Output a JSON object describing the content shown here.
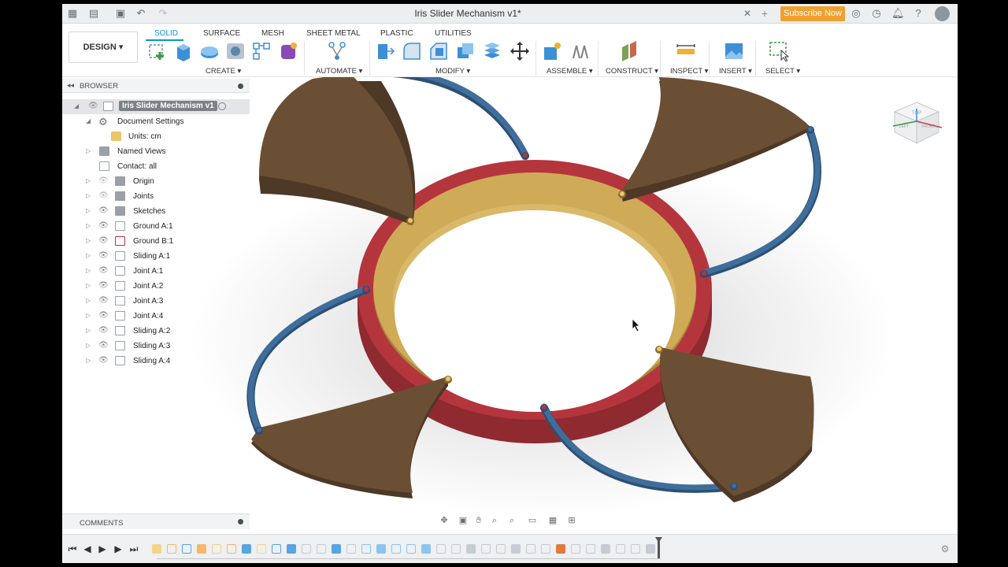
{
  "window": {
    "title": "Iris Slider Mechanism v1*",
    "subscribe_label": "Subscribe Now"
  },
  "ribbon": {
    "workspace": "DESIGN ▾",
    "tabs": [
      "SOLID",
      "SURFACE",
      "MESH",
      "SHEET METAL",
      "PLASTIC",
      "UTILITIES"
    ],
    "groups": [
      "CREATE ▾",
      "AUTOMATE ▾",
      "MODIFY ▾",
      "ASSEMBLE ▾",
      "CONSTRUCT ▾",
      "INSPECT ▾",
      "INSERT ▾",
      "SELECT ▾"
    ],
    "accent": "#0696d7"
  },
  "browser": {
    "header": "BROWSER",
    "root": "Iris Slider Mechanism v1",
    "items": [
      {
        "label": "Document Settings"
      },
      {
        "label": "Units: cm"
      },
      {
        "label": "Named Views"
      },
      {
        "label": "Contact: all"
      },
      {
        "label": "Origin"
      },
      {
        "label": "Joints"
      },
      {
        "label": "Sketches"
      },
      {
        "label": "Ground A:1"
      },
      {
        "label": "Ground B:1"
      },
      {
        "label": "Sliding A:1"
      },
      {
        "label": "Joint A:1"
      },
      {
        "label": "Joint A:2"
      },
      {
        "label": "Joint A:3"
      },
      {
        "label": "Joint A:4"
      },
      {
        "label": "Sliding A:2"
      },
      {
        "label": "Sliding A:3"
      },
      {
        "label": "Sliding A:4"
      }
    ]
  },
  "comments": {
    "header": "COMMENTS"
  },
  "viewcube": {
    "top": "TOP",
    "front": "FRONT",
    "left": "LEFT"
  },
  "colors": {
    "blade": "#6b4f34",
    "ring_outer": "#b5353d",
    "ring_inner": "#cfab57",
    "arm": "#3f6e9c",
    "subscribe": "#f0a030"
  }
}
